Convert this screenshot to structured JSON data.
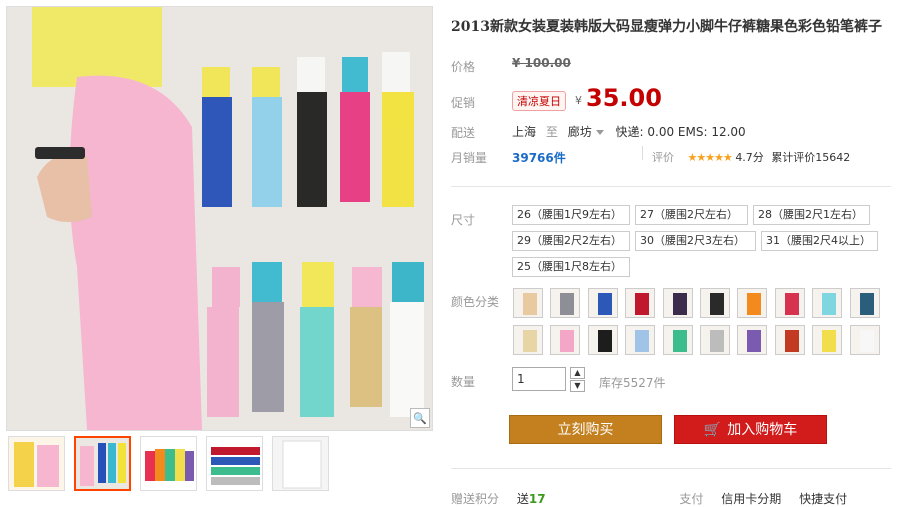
{
  "product": {
    "title": "2013新款女装夏装韩版大码显瘦弹力小脚牛仔裤糖果色彩色铅笔裤子"
  },
  "price": {
    "label": "价格",
    "original": "¥ 100.00"
  },
  "promo": {
    "label": "促销",
    "badge": "清凉夏日",
    "currency": "¥",
    "price": "35.00"
  },
  "shipping": {
    "label": "配送",
    "from": "上海",
    "to_prefix": "至",
    "to": "廊坊",
    "fee": "快递: 0.00 EMS: 12.00"
  },
  "sales": {
    "label": "月销量",
    "count": "39766件",
    "rating_label": "评价",
    "stars": "★★★★★",
    "score": "4.7分",
    "reviews": "累计评价15642"
  },
  "sizes": {
    "label": "尺寸",
    "options": [
      "26（腰围1尺9左右）",
      "27（腰围2尺左右）",
      "28（腰围2尺1左右）",
      "29（腰围2尺2左右）",
      "30（腰围2尺3左右）",
      "31（腰围2尺4以上）",
      "25（腰围1尺8左右）"
    ]
  },
  "colors": {
    "label": "颜色分类",
    "swatches": [
      "#e9c9a0",
      "#8e8e96",
      "#2c58b8",
      "#c0182c",
      "#3a2c4a",
      "#2a2a2a",
      "#f28a1e",
      "#d8334e",
      "#7fd6e0",
      "#2a5e7a",
      "#e7d5a6",
      "#f3a6c6",
      "#1d1d1d",
      "#9fc4e8",
      "#3dbd8e",
      "#bcbcbc",
      "#7a5bb0",
      "#c23a22",
      "#f2de4c",
      "#f7f7f7"
    ]
  },
  "quantity": {
    "label": "数量",
    "value": "1",
    "stock": "库存5527件"
  },
  "actions": {
    "buy_now": "立刻购买",
    "add_cart": "加入购物车"
  },
  "bottom": {
    "label": "赠送积分",
    "points_prefix": "送",
    "points": "17",
    "pay_prefix": "支付",
    "credit": "信用卡分期",
    "quick": "快捷支付"
  }
}
